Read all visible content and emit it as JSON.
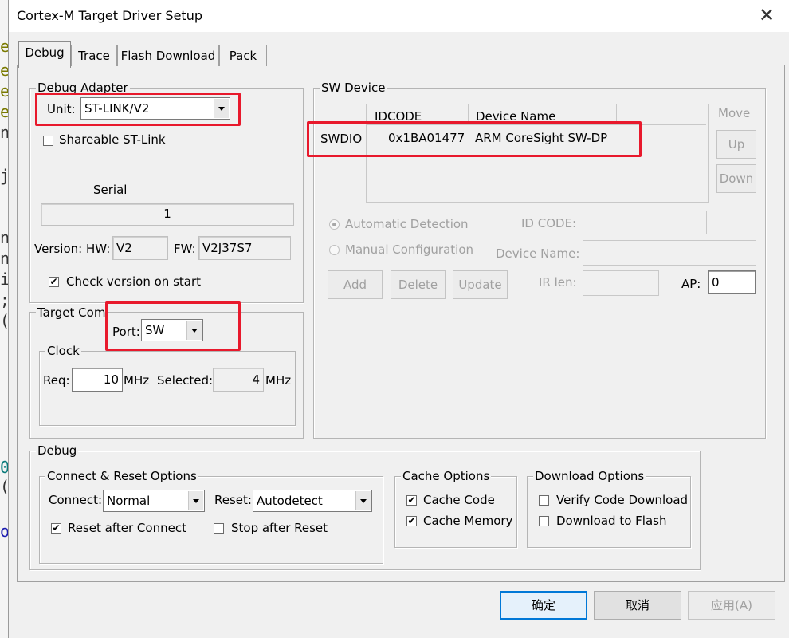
{
  "window": {
    "title": "Cortex-M Target Driver Setup",
    "close_glyph": "✕"
  },
  "tabs": [
    {
      "label": "Debug"
    },
    {
      "label": "Trace"
    },
    {
      "label": "Flash Download"
    },
    {
      "label": "Pack"
    }
  ],
  "debug_adapter": {
    "title": "Debug Adapter",
    "unit_label": "Unit:",
    "unit_value": "ST-LINK/V2",
    "shareable_label": "Shareable ST-Link",
    "shareable_checked": false,
    "serial_label": "Serial",
    "serial_value": "1",
    "version_label": "Version: HW:",
    "hw_value": "V2",
    "fw_label": "FW:",
    "fw_value": "V2J37S7",
    "check_version_label": "Check version on start",
    "check_version_checked": true
  },
  "target_com": {
    "title": "Target Com",
    "port_label": "Port:",
    "port_value": "SW",
    "clock": {
      "title": "Clock",
      "req_label": "Req:",
      "req_value": "10",
      "mhz1": "MHz",
      "selected_label": "Selected:",
      "selected_value": "4",
      "mhz2": "MHz"
    }
  },
  "sw_device": {
    "title": "SW Device",
    "col_idcode": "IDCODE",
    "col_device_name": "Device Name",
    "row_label": "SWDIO",
    "row_idcode": "0x1BA01477",
    "row_device": "ARM CoreSight SW-DP",
    "move_label": "Move",
    "up_label": "Up",
    "down_label": "Down",
    "auto_detect_label": "Automatic Detection",
    "manual_config_label": "Manual Configuration",
    "id_code_label": "ID CODE:",
    "device_name_label": "Device Name:",
    "add_label": "Add",
    "delete_label": "Delete",
    "update_label": "Update",
    "ir_len_label": "IR len:",
    "ap_label": "AP:",
    "ap_value": "0"
  },
  "debug": {
    "title": "Debug",
    "connect_reset": {
      "title": "Connect & Reset Options",
      "connect_label": "Connect:",
      "connect_value": "Normal",
      "reset_label": "Reset:",
      "reset_value": "Autodetect",
      "reset_after_connect_label": "Reset after Connect",
      "reset_after_connect_checked": true,
      "stop_after_reset_label": "Stop after Reset",
      "stop_after_reset_checked": false
    },
    "cache_options": {
      "title": "Cache Options",
      "cache_code_label": "Cache Code",
      "cache_code_checked": true,
      "cache_memory_label": "Cache Memory",
      "cache_memory_checked": true
    },
    "download_options": {
      "title": "Download Options",
      "verify_label": "Verify Code Download",
      "verify_checked": false,
      "download_flash_label": "Download to Flash",
      "download_flash_checked": false
    }
  },
  "buttons": {
    "ok": "确定",
    "cancel": "取消",
    "apply": "应用(A)"
  },
  "checkmark_glyph": "✔",
  "background_code_chars": [
    "e",
    "e",
    "e",
    "e",
    "n",
    "j",
    "n",
    "n",
    "i",
    ";",
    "(",
    "0",
    "(",
    "o"
  ],
  "colors": {
    "highlight_box": "#e8192c",
    "dialog_bg": "#f0f0f0",
    "default_button_border": "#0078d7"
  }
}
